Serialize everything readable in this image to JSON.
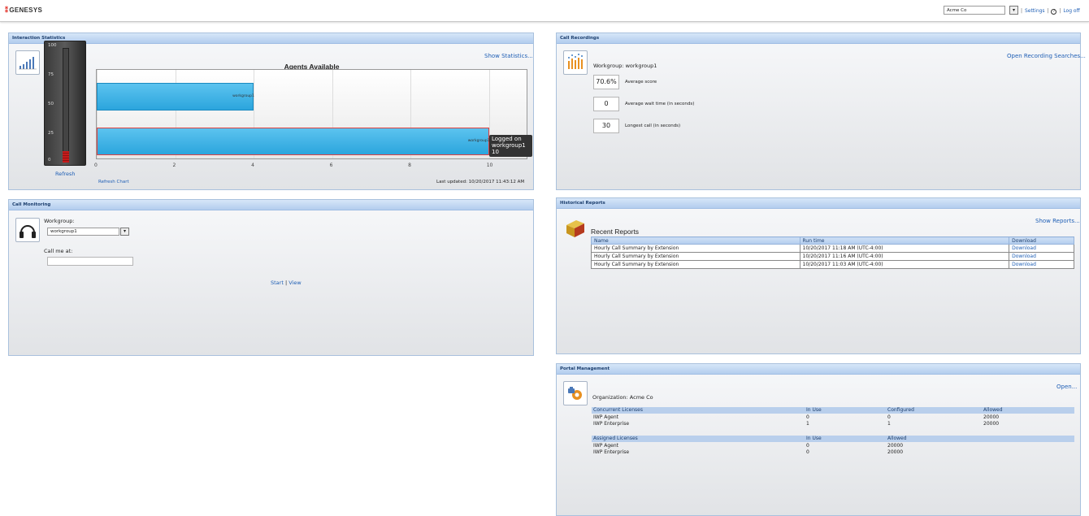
{
  "header": {
    "logo": "GENESYS",
    "tenant_value": "Acme Co",
    "links": {
      "settings": "Settings",
      "help_icon": "?",
      "logoff": "Log off"
    }
  },
  "interaction_stats": {
    "title": "Interaction Statistics",
    "workgroup_link": "workgroup1",
    "show_link": "Show Statistics...",
    "refresh": "Refresh",
    "refresh_chart": "Refresh Chart",
    "last_updated": "Last updated: 10/20/2017 11:43:12 AM",
    "gauge": {
      "ticks": [
        "100",
        "75",
        "50",
        "25",
        "0"
      ],
      "value": 10,
      "max": 100
    }
  },
  "chart_data": {
    "type": "bar",
    "title": "Agents Available",
    "orientation": "horizontal",
    "categories": [
      "workgroup1",
      "workgroup1"
    ],
    "values": [
      4,
      10
    ],
    "xlim": [
      0,
      11
    ],
    "xticks": [
      "0",
      "2",
      "4",
      "6",
      "8",
      "10"
    ],
    "tooltip": {
      "lines": [
        "Logged on",
        "workgroup1",
        "10"
      ]
    },
    "bar_color": "#2ba5dd",
    "highlight_color": "#e04040"
  },
  "call_recordings": {
    "title": "Call Recordings",
    "open_link": "Open Recording Searches...",
    "workgroup": "Workgroup: workgroup1",
    "metrics": [
      {
        "value": "70.6%",
        "label": "Average score"
      },
      {
        "value": "0",
        "label": "Average wait time (in seconds)"
      },
      {
        "value": "30",
        "label": "Longest call (in seconds)"
      }
    ]
  },
  "call_monitoring": {
    "title": "Call Monitoring",
    "workgroup_label": "Workgroup:",
    "workgroup_value": "workgroup1",
    "call_me_label": "Call me at:",
    "call_me_value": "",
    "start": "Start",
    "sep": "|",
    "view": "View"
  },
  "historical_reports": {
    "title": "Historical Reports",
    "show_link": "Show Reports...",
    "recent": "Recent Reports",
    "columns": [
      "Name",
      "Run time",
      "Download"
    ],
    "rows": [
      [
        "Hourly Call Summary by Extension",
        "10/20/2017 11:18 AM (UTC-4:00)",
        "Download"
      ],
      [
        "Hourly Call Summary by Extension",
        "10/20/2017 11:16 AM (UTC-4:00)",
        "Download"
      ],
      [
        "Hourly Call Summary by Extension",
        "10/20/2017 11:03 AM (UTC-4:00)",
        "Download"
      ]
    ]
  },
  "portal": {
    "title": "Portal Management",
    "open_link": "Open...",
    "organization": "Organization: Acme Co",
    "concurrent": {
      "head": [
        "Concurrent Licenses",
        "In Use",
        "Configured",
        "Allowed"
      ],
      "rows": [
        [
          "IWP Agent",
          "0",
          "0",
          "20000"
        ],
        [
          "IWP Enterprise",
          "1",
          "1",
          "20000"
        ]
      ]
    },
    "assigned": {
      "head": [
        "Assigned Licenses",
        "In Use",
        "Allowed"
      ],
      "rows": [
        [
          "IWP Agent",
          "0",
          "20000"
        ],
        [
          "IWP Enterprise",
          "0",
          "20000"
        ]
      ]
    }
  }
}
